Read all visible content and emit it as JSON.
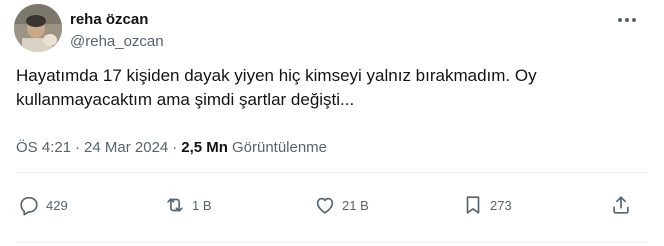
{
  "author": {
    "name": "reha özcan",
    "handle": "@reha_ozcan"
  },
  "tweet": {
    "text": "Hayatımda 17 kişiden dayak yiyen hiç kimseyi yalnız bırakmadım. Oy\nkullanmayacaktım ama şimdi şartlar değişti...",
    "time": "ÖS 4:21",
    "date": "24 Mar 2024",
    "separator": "·",
    "views_count": "2,5 Mn",
    "views_label": "Görüntülenme"
  },
  "actions": {
    "reply_count": "429",
    "retweet_count": "1 B",
    "like_count": "21 B",
    "bookmark_count": "273"
  },
  "icons": [
    "avatar-photo",
    "more-icon",
    "reply-icon",
    "retweet-icon",
    "like-icon",
    "bookmark-icon",
    "share-icon"
  ],
  "colors": {
    "text": "#0f1419",
    "secondary": "#536471",
    "divider": "#eff3f4"
  }
}
